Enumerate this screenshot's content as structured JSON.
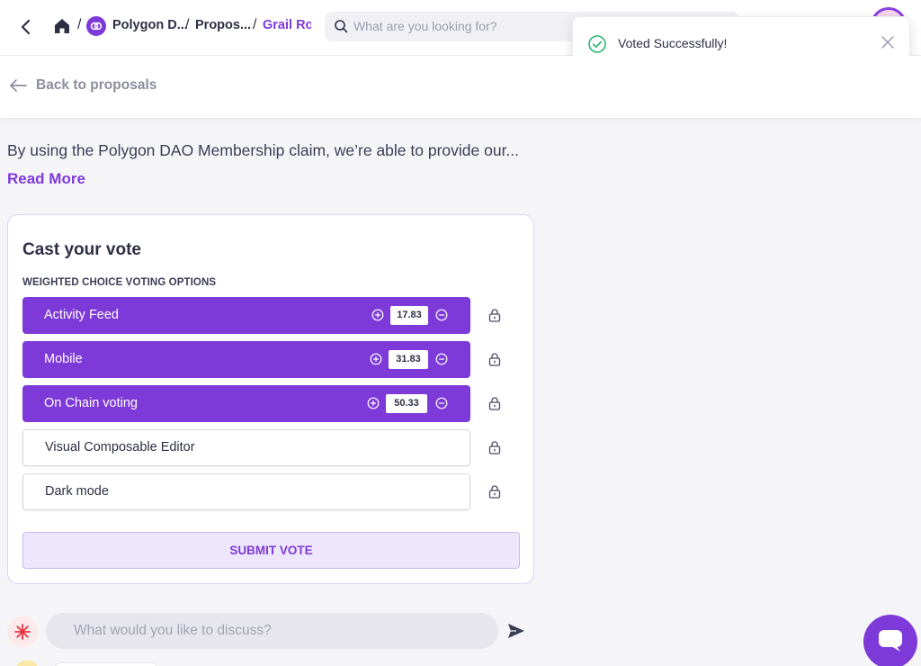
{
  "breadcrumb": {
    "sep": "/",
    "dao": "Polygon D...",
    "proposals": "Propos...",
    "current": "Grail Ro:"
  },
  "search": {
    "placeholder": "What are you looking for?"
  },
  "toast": {
    "message": "Voted Successfully!"
  },
  "nav": {
    "back_label": "Back to proposals"
  },
  "proposal": {
    "summary": "By using the Polygon DAO Membership claim, we’re able to provide our...",
    "read_more": "Read More"
  },
  "vote": {
    "title": "Cast your vote",
    "subtitle": "WEIGHTED CHOICE VOTING OPTIONS",
    "options": [
      {
        "label": "Activity Feed",
        "value": "17.83",
        "selected": true
      },
      {
        "label": "Mobile",
        "value": "31.83",
        "selected": true
      },
      {
        "label": "On Chain voting",
        "value": "50.33",
        "selected": true
      },
      {
        "label": "Visual Composable Editor",
        "selected": false
      },
      {
        "label": "Dark mode",
        "selected": false
      }
    ],
    "submit_label": "SUBMIT VOTE"
  },
  "discussion": {
    "placeholder": "What would you like to discuss?"
  },
  "colors": {
    "accent": "#7e3ad8",
    "success": "#2bb673",
    "text": "#2d2f45"
  },
  "icons": [
    "chevron-left-icon",
    "home-icon",
    "polygon-logo-icon",
    "search-icon",
    "check-circle-icon",
    "close-icon",
    "arrow-left-icon",
    "plus-circle-icon",
    "minus-circle-icon",
    "lock-icon",
    "asterisk-icon",
    "send-icon",
    "chat-icon"
  ]
}
